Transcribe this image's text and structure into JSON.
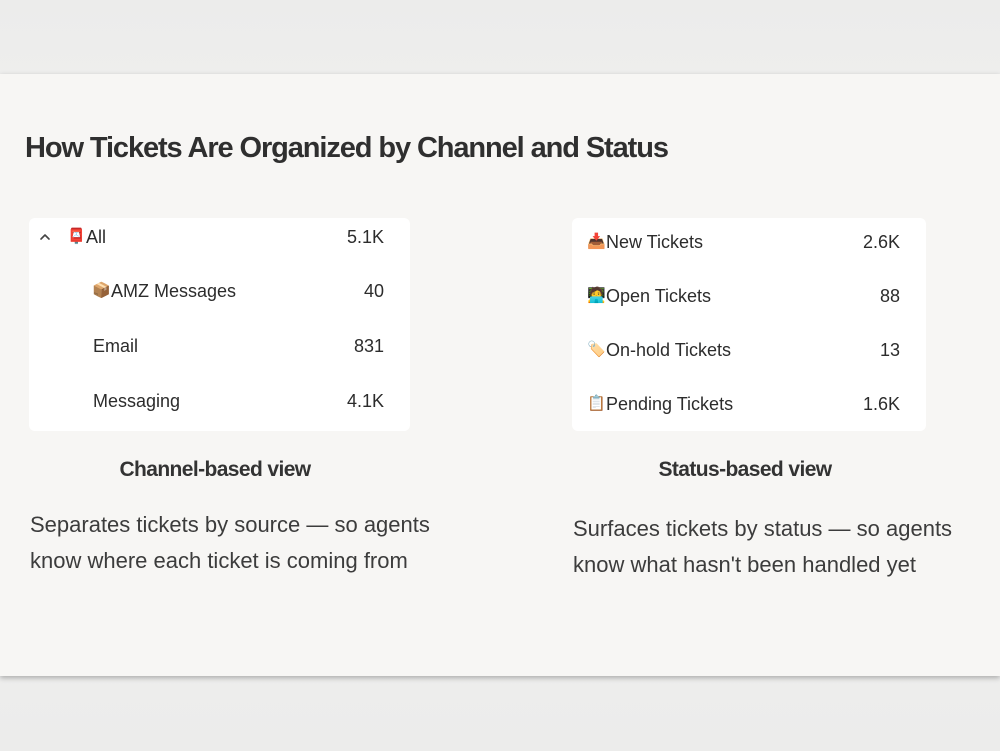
{
  "title": "How Tickets Are Organized by Channel and Status",
  "channel_view": {
    "all": {
      "icon": "postbox-icon",
      "glyph": "📮",
      "label": "All",
      "count": "5.1K"
    },
    "items": [
      {
        "icon": "package-icon",
        "glyph": "📦",
        "label": "AMZ Messages",
        "count": "40"
      },
      {
        "icon": "",
        "glyph": "",
        "label": "Email",
        "count": "831"
      },
      {
        "icon": "",
        "glyph": "",
        "label": "Messaging",
        "count": "4.1K"
      }
    ],
    "caption": "Channel-based view",
    "description": "Separates tickets by source — so agents know where each ticket is coming from"
  },
  "status_view": {
    "items": [
      {
        "icon": "inbox-tray-icon",
        "glyph": "📥",
        "label": "New Tickets",
        "count": "2.6K"
      },
      {
        "icon": "technologist-icon",
        "glyph": "🧑‍💻",
        "label": "Open Tickets",
        "count": "88"
      },
      {
        "icon": "label-tag-icon",
        "glyph": "🏷️",
        "label": "On-hold Tickets",
        "count": "13"
      },
      {
        "icon": "clipboard-icon",
        "glyph": "📋",
        "label": "Pending Tickets",
        "count": "1.6K"
      }
    ],
    "caption": "Status-based view",
    "description": "Surfaces tickets by status — so agents know what hasn't been handled yet"
  },
  "colors": {
    "card_background": "#f7f6f4",
    "panel_background": "#ffffff",
    "text": "#2c2c2c"
  }
}
